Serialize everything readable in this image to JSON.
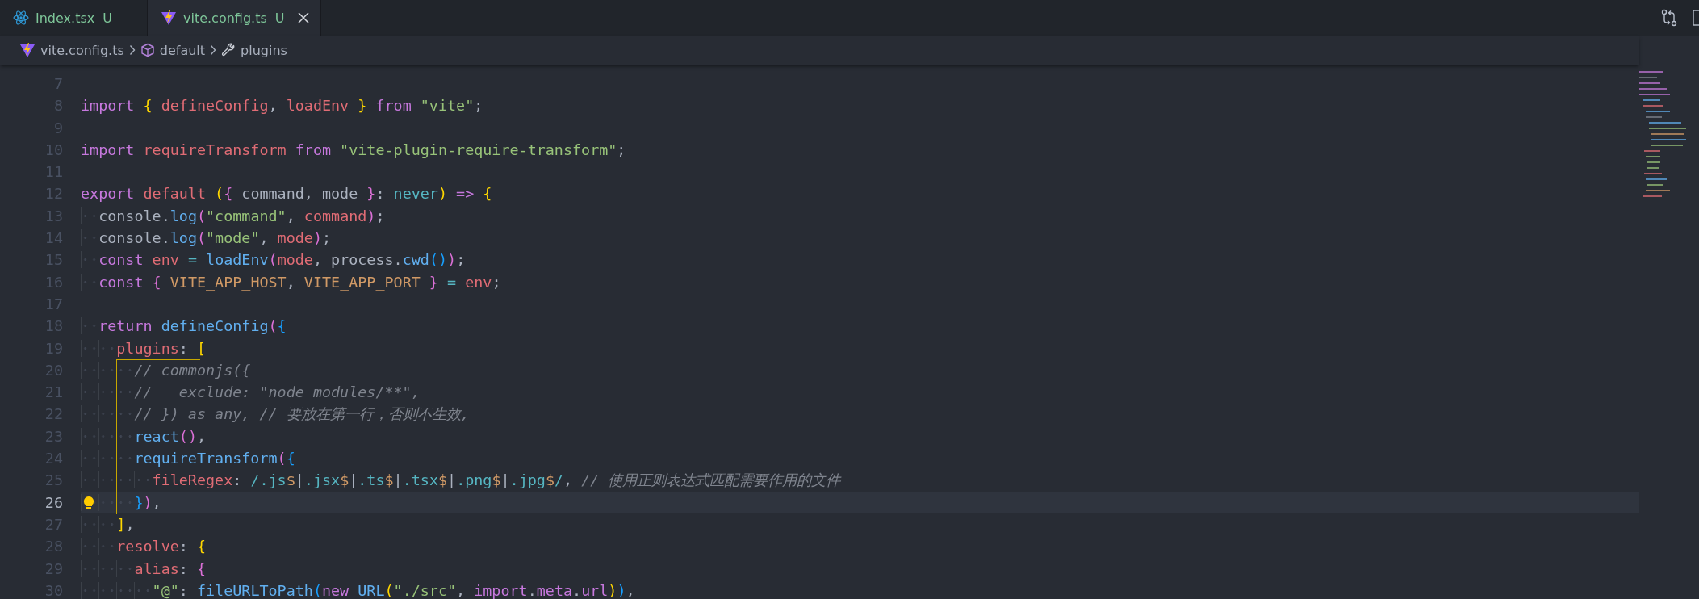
{
  "tabs": [
    {
      "label": "Index.tsx",
      "status": "U",
      "kind": "react",
      "selected": false
    },
    {
      "label": "vite.config.ts",
      "status": "U",
      "kind": "vite",
      "selected": true
    }
  ],
  "breadcrumb": [
    {
      "label": "vite.config.ts",
      "kind": "file"
    },
    {
      "label": "default",
      "kind": "module"
    },
    {
      "label": "plugins",
      "kind": "property"
    }
  ],
  "editor": {
    "lines": [
      {
        "number": "7",
        "current": false,
        "lightbulb": false
      },
      {
        "number": "8",
        "current": false,
        "lightbulb": false,
        "tokens": [
          {
            "text": "import",
            "kind": "kw"
          },
          {
            "text": " {",
            "kind": "b1"
          },
          {
            "text": " defineConfig",
            "kind": "var"
          },
          {
            "text": ",",
            "kind": "p"
          },
          {
            "text": " loadEnv",
            "kind": "var"
          },
          {
            "text": " }",
            "kind": "b1"
          },
          {
            "text": " from",
            "kind": "kw"
          },
          {
            "text": " \"vite\"",
            "kind": "str"
          },
          {
            "text": ";",
            "kind": "p"
          }
        ]
      },
      {
        "number": "9",
        "current": false,
        "lightbulb": false
      },
      {
        "number": "10",
        "current": false,
        "lightbulb": false,
        "tokens": [
          {
            "text": "import",
            "kind": "kw"
          },
          {
            "text": " requireTransform",
            "kind": "var"
          },
          {
            "text": " from",
            "kind": "kw"
          },
          {
            "text": " \"vite-plugin-require-transform\"",
            "kind": "str"
          },
          {
            "text": ";",
            "kind": "p"
          }
        ]
      },
      {
        "number": "11",
        "current": false,
        "lightbulb": false
      },
      {
        "number": "12",
        "current": false,
        "lightbulb": false,
        "tokens": [
          {
            "text": "export",
            "kind": "kw"
          },
          {
            "text": " default",
            "kind": "var"
          },
          {
            "text": " (",
            "kind": "b1"
          },
          {
            "text": "{",
            "kind": "b2"
          },
          {
            "text": " command, mode",
            "kind": "p"
          },
          {
            "text": " }",
            "kind": "b2"
          },
          {
            "text": ":",
            "kind": "p"
          },
          {
            "text": " never",
            "kind": "type"
          },
          {
            "text": ")",
            "kind": "b1"
          },
          {
            "text": " =>",
            "kind": "kw"
          },
          {
            "text": " {",
            "kind": "b1"
          }
        ]
      },
      {
        "number": "13",
        "current": false,
        "lightbulb": false,
        "tokens": [
          {
            "text": "  console.",
            "kind": "p"
          },
          {
            "text": "log",
            "kind": "fn"
          },
          {
            "text": "(",
            "kind": "b2"
          },
          {
            "text": "\"command\"",
            "kind": "str"
          },
          {
            "text": ",",
            "kind": "p"
          },
          {
            "text": " command",
            "kind": "var"
          },
          {
            "text": ")",
            "kind": "b2"
          },
          {
            "text": ";",
            "kind": "p"
          }
        ]
      },
      {
        "number": "14",
        "current": false,
        "lightbulb": false,
        "tokens": [
          {
            "text": "  console.",
            "kind": "p"
          },
          {
            "text": "log",
            "kind": "fn"
          },
          {
            "text": "(",
            "kind": "b2"
          },
          {
            "text": "\"mode\"",
            "kind": "str"
          },
          {
            "text": ",",
            "kind": "p"
          },
          {
            "text": " mode",
            "kind": "var"
          },
          {
            "text": ")",
            "kind": "b2"
          },
          {
            "text": ";",
            "kind": "p"
          }
        ]
      },
      {
        "number": "15",
        "current": false,
        "lightbulb": false,
        "tokens": [
          {
            "text": "  const",
            "kind": "kw"
          },
          {
            "text": " env",
            "kind": "var"
          },
          {
            "text": " =",
            "kind": "op"
          },
          {
            "text": " loadEnv",
            "kind": "fn"
          },
          {
            "text": "(",
            "kind": "b2"
          },
          {
            "text": "mode",
            "kind": "var"
          },
          {
            "text": ", process.",
            "kind": "p"
          },
          {
            "text": "cwd",
            "kind": "fn"
          },
          {
            "text": "()",
            "kind": "b3"
          },
          {
            "text": ")",
            "kind": "b2"
          },
          {
            "text": ";",
            "kind": "p"
          }
        ]
      },
      {
        "number": "16",
        "current": false,
        "lightbulb": false,
        "tokens": [
          {
            "text": "  const",
            "kind": "kw"
          },
          {
            "text": " {",
            "kind": "b2"
          },
          {
            "text": " VITE_APP_HOST",
            "kind": "const"
          },
          {
            "text": ",",
            "kind": "p"
          },
          {
            "text": " VITE_APP_PORT",
            "kind": "const"
          },
          {
            "text": " }",
            "kind": "b2"
          },
          {
            "text": " =",
            "kind": "op"
          },
          {
            "text": " env",
            "kind": "var"
          },
          {
            "text": ";",
            "kind": "p"
          }
        ]
      },
      {
        "number": "17",
        "current": false,
        "lightbulb": false
      },
      {
        "number": "18",
        "current": false,
        "lightbulb": false,
        "tokens": [
          {
            "text": "  return",
            "kind": "kw"
          },
          {
            "text": " defineConfig",
            "kind": "fn"
          },
          {
            "text": "(",
            "kind": "b2"
          },
          {
            "text": "{",
            "kind": "b3"
          }
        ]
      },
      {
        "number": "19",
        "current": false,
        "lightbulb": false,
        "tokens": [
          {
            "text": "    plugins",
            "kind": "var"
          },
          {
            "text": ":",
            "kind": "p"
          },
          {
            "text": " [",
            "kind": "b1"
          }
        ]
      },
      {
        "number": "20",
        "current": false,
        "lightbulb": false,
        "tokens": [
          {
            "text": "      // commonjs({",
            "kind": "com"
          }
        ]
      },
      {
        "number": "21",
        "current": false,
        "lightbulb": false,
        "tokens": [
          {
            "text": "      //   exclude: \"node_modules/**\",",
            "kind": "com"
          }
        ]
      },
      {
        "number": "22",
        "current": false,
        "lightbulb": false,
        "tokens": [
          {
            "text": "      // }) as any, // 要放在第一行，否则不生效,",
            "kind": "com"
          }
        ]
      },
      {
        "number": "23",
        "current": false,
        "lightbulb": false,
        "tokens": [
          {
            "text": "      react",
            "kind": "fn"
          },
          {
            "text": "()",
            "kind": "b2"
          },
          {
            "text": ",",
            "kind": "p"
          }
        ]
      },
      {
        "number": "24",
        "current": false,
        "lightbulb": false,
        "tokens": [
          {
            "text": "      requireTransform",
            "kind": "fn"
          },
          {
            "text": "(",
            "kind": "b2"
          },
          {
            "text": "{",
            "kind": "b3"
          }
        ]
      },
      {
        "number": "25",
        "current": false,
        "lightbulb": false,
        "tokens": [
          {
            "text": "        fileRegex",
            "kind": "var"
          },
          {
            "text": ":",
            "kind": "p"
          },
          {
            "text": " /.js",
            "kind": "re"
          },
          {
            "text": "$",
            "kind": "anc"
          },
          {
            "text": "|",
            "kind": "p"
          },
          {
            "text": ".jsx",
            "kind": "re"
          },
          {
            "text": "$",
            "kind": "anc"
          },
          {
            "text": "|",
            "kind": "p"
          },
          {
            "text": ".ts",
            "kind": "re"
          },
          {
            "text": "$",
            "kind": "anc"
          },
          {
            "text": "|",
            "kind": "p"
          },
          {
            "text": ".tsx",
            "kind": "re"
          },
          {
            "text": "$",
            "kind": "anc"
          },
          {
            "text": "|",
            "kind": "p"
          },
          {
            "text": ".png",
            "kind": "re"
          },
          {
            "text": "$",
            "kind": "anc"
          },
          {
            "text": "|",
            "kind": "p"
          },
          {
            "text": ".jpg",
            "kind": "re"
          },
          {
            "text": "$",
            "kind": "anc"
          },
          {
            "text": "/",
            "kind": "re"
          },
          {
            "text": ",",
            "kind": "p"
          },
          {
            "text": " // 使用正则表达式匹配需要作用的文件",
            "kind": "com"
          }
        ]
      },
      {
        "number": "26",
        "current": true,
        "lightbulb": true,
        "tokens": [
          {
            "text": "      }",
            "kind": "b3"
          },
          {
            "text": ")",
            "kind": "b2"
          },
          {
            "text": ",",
            "kind": "p"
          }
        ]
      },
      {
        "number": "27",
        "current": false,
        "lightbulb": false,
        "tokens": [
          {
            "text": "    ]",
            "kind": "b1"
          },
          {
            "text": ",",
            "kind": "p"
          }
        ]
      },
      {
        "number": "28",
        "current": false,
        "lightbulb": false,
        "tokens": [
          {
            "text": "    resolve",
            "kind": "var"
          },
          {
            "text": ":",
            "kind": "p"
          },
          {
            "text": " {",
            "kind": "b1"
          }
        ]
      },
      {
        "number": "29",
        "current": false,
        "lightbulb": false,
        "tokens": [
          {
            "text": "      alias",
            "kind": "var"
          },
          {
            "text": ":",
            "kind": "p"
          },
          {
            "text": " {",
            "kind": "b2"
          }
        ]
      },
      {
        "number": "30",
        "current": false,
        "lightbulb": false,
        "tokens": [
          {
            "text": "        \"@\"",
            "kind": "str"
          },
          {
            "text": ":",
            "kind": "p"
          },
          {
            "text": " fileURLToPath",
            "kind": "fn"
          },
          {
            "text": "(",
            "kind": "b3"
          },
          {
            "text": "new",
            "kind": "kw"
          },
          {
            "text": " URL",
            "kind": "fn"
          },
          {
            "text": "(",
            "kind": "b1"
          },
          {
            "text": "\"./src\"",
            "kind": "str"
          },
          {
            "text": ",",
            "kind": "p"
          },
          {
            "text": " import",
            "kind": "kw"
          },
          {
            "text": ".",
            "kind": "p"
          },
          {
            "text": "meta",
            "kind": "kw"
          },
          {
            "text": ".",
            "kind": "p"
          },
          {
            "text": "url",
            "kind": "kw"
          },
          {
            "text": ")",
            "kind": "b1"
          },
          {
            "text": ")",
            "kind": "b3"
          },
          {
            "text": ",",
            "kind": "p"
          }
        ]
      }
    ]
  }
}
